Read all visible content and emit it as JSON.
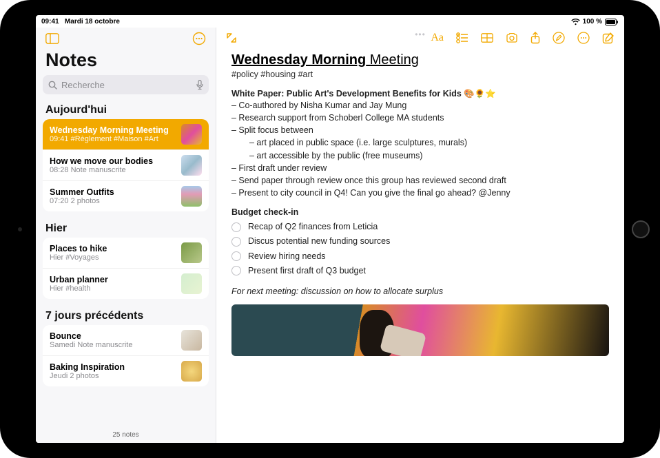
{
  "status": {
    "time": "09:41",
    "date": "Mardi 18 octobre",
    "battery_pct": "100 %"
  },
  "sidebar": {
    "title": "Notes",
    "search_placeholder": "Recherche",
    "sections": [
      {
        "header": "Aujourd'hui",
        "items": [
          {
            "title": "Wednesday Morning Meeting",
            "time": "09:41",
            "sub": "#Règlement #Maison #Art",
            "selected": true,
            "thumb_color": "linear-gradient(135deg,#d88b26,#e04e9e,#e8b730)"
          },
          {
            "title": "How we move our bodies",
            "time": "08:28",
            "sub": "Note manuscrite",
            "thumb_color": "linear-gradient(135deg,#cde,#9bc,#fde)"
          },
          {
            "title": "Summer Outfits",
            "time": "07:20",
            "sub": "2 photos",
            "thumb_color": "linear-gradient(0deg,#8fbf6a,#e29bb6 60%,#a7c9e8)"
          }
        ]
      },
      {
        "header": "Hier",
        "items": [
          {
            "title": "Places to hike",
            "time": "Hier",
            "sub": "#Voyages",
            "thumb_color": "linear-gradient(135deg,#7a9a46,#b8c88a)"
          },
          {
            "title": "Urban planner",
            "time": "Hier",
            "sub": "#health",
            "thumb_color": "linear-gradient(135deg,#d4eecf,#e8f3d2)"
          }
        ]
      },
      {
        "header": "7 jours précédents",
        "items": [
          {
            "title": "Bounce",
            "time": "Samedi",
            "sub": "Note manuscrite",
            "thumb_color": "linear-gradient(135deg,#e7e3da,#c9b8a1)"
          },
          {
            "title": "Baking Inspiration",
            "time": "Jeudi",
            "sub": "2 photos",
            "thumb_color": "radial-gradient(circle,#f4d77e,#d8a94a)"
          }
        ]
      }
    ],
    "footer": "25 notes"
  },
  "doc": {
    "title_bold": "Wednesday Morning",
    "title_rest": " Meeting",
    "hashtags": "#policy #housing #art",
    "paper_heading": "White Paper: Public Art's Development Benefits for Kids 🎨🌻⭐",
    "lines": [
      "– Co-authored by Nisha Kumar and Jay Mung",
      "– Research support from Schoberl College MA students",
      "– Split focus between"
    ],
    "indented": [
      "– art placed in public space (i.e. large sculptures, murals)",
      "– art accessible by the public (free museums)"
    ],
    "lines2": [
      "– First draft under review",
      "– Send paper through review once this group has reviewed second draft",
      "– Present to city council in Q4! Can you give the final go ahead? @Jenny"
    ],
    "budget_heading": "Budget check-in",
    "checklist": [
      "Recap of Q2 finances from Leticia",
      "Discus potential new funding sources",
      "Review hiring needs",
      "Present first draft of Q3 budget"
    ],
    "italic_note": "For next meeting: discussion on how to allocate surplus"
  },
  "colors": {
    "accent": "#f2a900"
  }
}
